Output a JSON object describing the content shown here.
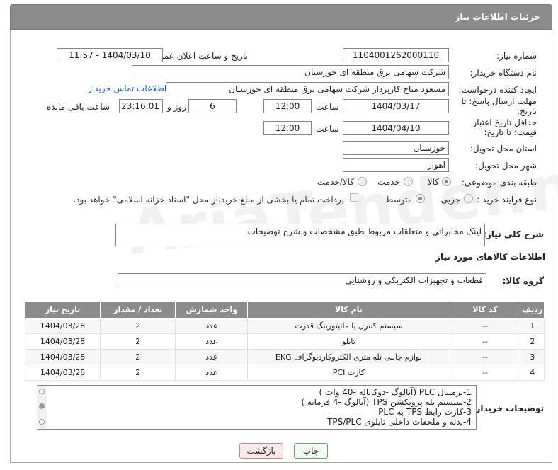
{
  "header": {
    "title": "جزئیات اطلاعات نیاز"
  },
  "form": {
    "need_number_label": "شماره نیاز:",
    "need_number": "1104001262000110",
    "announce_label": "تاریخ و ساعت اعلان عمومی:",
    "announce_value": "1404/03/10 - 11:57",
    "buyer_org_label": "نام دستگاه خریدار:",
    "buyer_org": "شرکت سهامی برق منطقه ای خوزستان",
    "creator_label": "ایجاد کننده درخواست:",
    "creator": "مسعود میاح کارپرداز شرکت سهامی برق منطقه ای خوزستان",
    "buyer_contact_link": "اطلاعات تماس خریدار",
    "reply_deadline_label": "مهلت ارسال پاسخ: تا تاریخ:",
    "reply_date": "1404/03/17",
    "time_label": "ساعت",
    "reply_time": "12:00",
    "days_value": "6",
    "days_label": "روز و",
    "remaining_time": "23:16:01",
    "remaining_label": "ساعت باقی مانده",
    "validity_label": "حداقل تاریخ اعتبار قیمت: تا تاریخ:",
    "validity_date": "1404/04/10",
    "validity_time": "12:00",
    "province_label": "استان محل تحویل:",
    "province": "خوزستان",
    "city_label": "شهر محل تحویل:",
    "city": "اهواز",
    "category_label": "طبقه بندی موضوعی:",
    "category_options": [
      "کالا",
      "خدمت",
      "کالا/خدمت"
    ],
    "process_label": "نوع فرآیند خرید :",
    "process_options": [
      "جزیی",
      "متوسط"
    ],
    "payment_note": "پرداخت تمام یا بخشی از مبلغ خرید،از محل \"اسناد خزانه اسلامی\" خواهد بود.",
    "description_label": "شرح کلی نیاز:",
    "description": "لینک مخابراتی و متعلقات مربوط طبق مشخصات و شرح توضیحات",
    "goods_info_title": "اطلاعات کالاهای مورد نیاز",
    "goods_group_label": "گروه کالا:",
    "goods_group": "قطعات و تجهیزات الکتریکی و روشنایی"
  },
  "table": {
    "headers": [
      "ردیف",
      "کد کالا",
      "نام کالا",
      "واحد شمارش",
      "تعداد / مقدار",
      "تاریخ نیاز"
    ],
    "rows": [
      [
        "1",
        "--",
        "سیستم کنترل یا مانیتورینگ قدرت",
        "عدد",
        "2",
        "1404/03/28"
      ],
      [
        "2",
        "--",
        "تابلو",
        "عدد",
        "2",
        "1404/03/28"
      ],
      [
        "3",
        "--",
        "لوازم جانبی تله متری الکتروکاردیوگراف EKG",
        "عدد",
        "2",
        "1404/03/28"
      ],
      [
        "4",
        "--",
        "کارت PCI",
        "عدد",
        "2",
        "1404/03/28"
      ]
    ]
  },
  "notes": {
    "label": "توضیحات خریدار:",
    "lines": [
      "1-ترمینال PLC (آنالوگ -دوکاناله -40 وات )",
      "2-سیستم تله پروتکشن TPS (آنالوگ -4 فرمانه )",
      "3-کارت رابط TPS به PLC",
      "4-بدنه و ملحقات داخلی تابلوی TPS/PLC"
    ]
  },
  "buttons": {
    "print": "چاپ",
    "back": "بازگشت"
  },
  "watermark": "AriaTender.neT"
}
